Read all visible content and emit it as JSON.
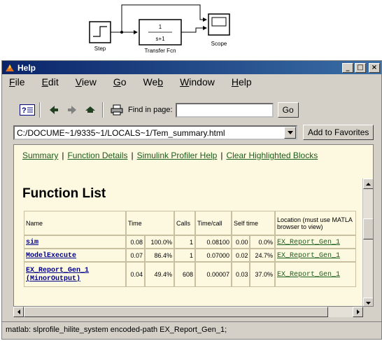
{
  "diagram": {
    "blocks": {
      "step_label": "Step",
      "tf_label": "Transfer Fcn",
      "tf_numerator": "1",
      "tf_denominator": "s+1",
      "scope_label": "Scope"
    }
  },
  "window": {
    "title": "Help",
    "controls": {
      "minimize": "_",
      "maximize": "□",
      "close": "×"
    }
  },
  "menu": {
    "items": [
      {
        "label": "File",
        "hotkey_index": 0
      },
      {
        "label": "Edit",
        "hotkey_index": 0
      },
      {
        "label": "View",
        "hotkey_index": 0
      },
      {
        "label": "Go",
        "hotkey_index": 0
      },
      {
        "label": "Web",
        "hotkey_index": 2
      },
      {
        "label": "Window",
        "hotkey_index": 0
      },
      {
        "label": "Help",
        "hotkey_index": 0
      }
    ]
  },
  "toolbar": {
    "icons": [
      "help-navigator-icon",
      "back-icon",
      "forward-icon",
      "home-icon",
      "print-icon"
    ],
    "find_label": "Find in page:",
    "find_value": "",
    "go_label": "Go"
  },
  "address": {
    "url": "C:/DOCUME~1/9335~1/LOCALS~1/Tem_summary.html",
    "add_favorites_label": "Add to Favorites"
  },
  "page": {
    "nav_links": [
      "Summary",
      "Function Details",
      "Simulink Profiler Help",
      "Clear Highlighted Blocks"
    ],
    "title": "Function List",
    "table": {
      "headers": {
        "name": "Name",
        "time": "Time",
        "calls": "Calls",
        "time_per_call": "Time/call",
        "self_time": "Self time",
        "location_line1": "Location (must use MATLA",
        "location_line2": "browser to view)"
      },
      "rows": [
        {
          "name": "sim",
          "name_line2": "",
          "time": "0.08",
          "time_pct": "100.0%",
          "calls": "1",
          "time_per_call": "0.08100",
          "self_time": "0.00",
          "self_pct": "0.0%",
          "location": "EX_Report_Gen_1"
        },
        {
          "name": "ModelExecute",
          "name_line2": "",
          "time": "0.07",
          "time_pct": "86.4%",
          "calls": "1",
          "time_per_call": "0.07000",
          "self_time": "0.02",
          "self_pct": "24.7%",
          "location": "EX_Report_Gen_1"
        },
        {
          "name": "EX_Report_Gen_1",
          "name_line2": "(MinorOutput)",
          "time": "0.04",
          "time_pct": "49.4%",
          "calls": "608",
          "time_per_call": "0.00007",
          "self_time": "0.03",
          "self_pct": "37.0%",
          "location": "EX_Report_Gen_1"
        }
      ]
    }
  },
  "status": {
    "text": "matlab: slprofile_hilite_system encoded-path EX_Report_Gen_1;"
  },
  "colors": {
    "title_bar": "#0a246a",
    "content_bg": "#fdf8e0",
    "nav_link": "#1a5c1a",
    "function_link": "#00008b",
    "chrome": "#d4d0c8"
  }
}
